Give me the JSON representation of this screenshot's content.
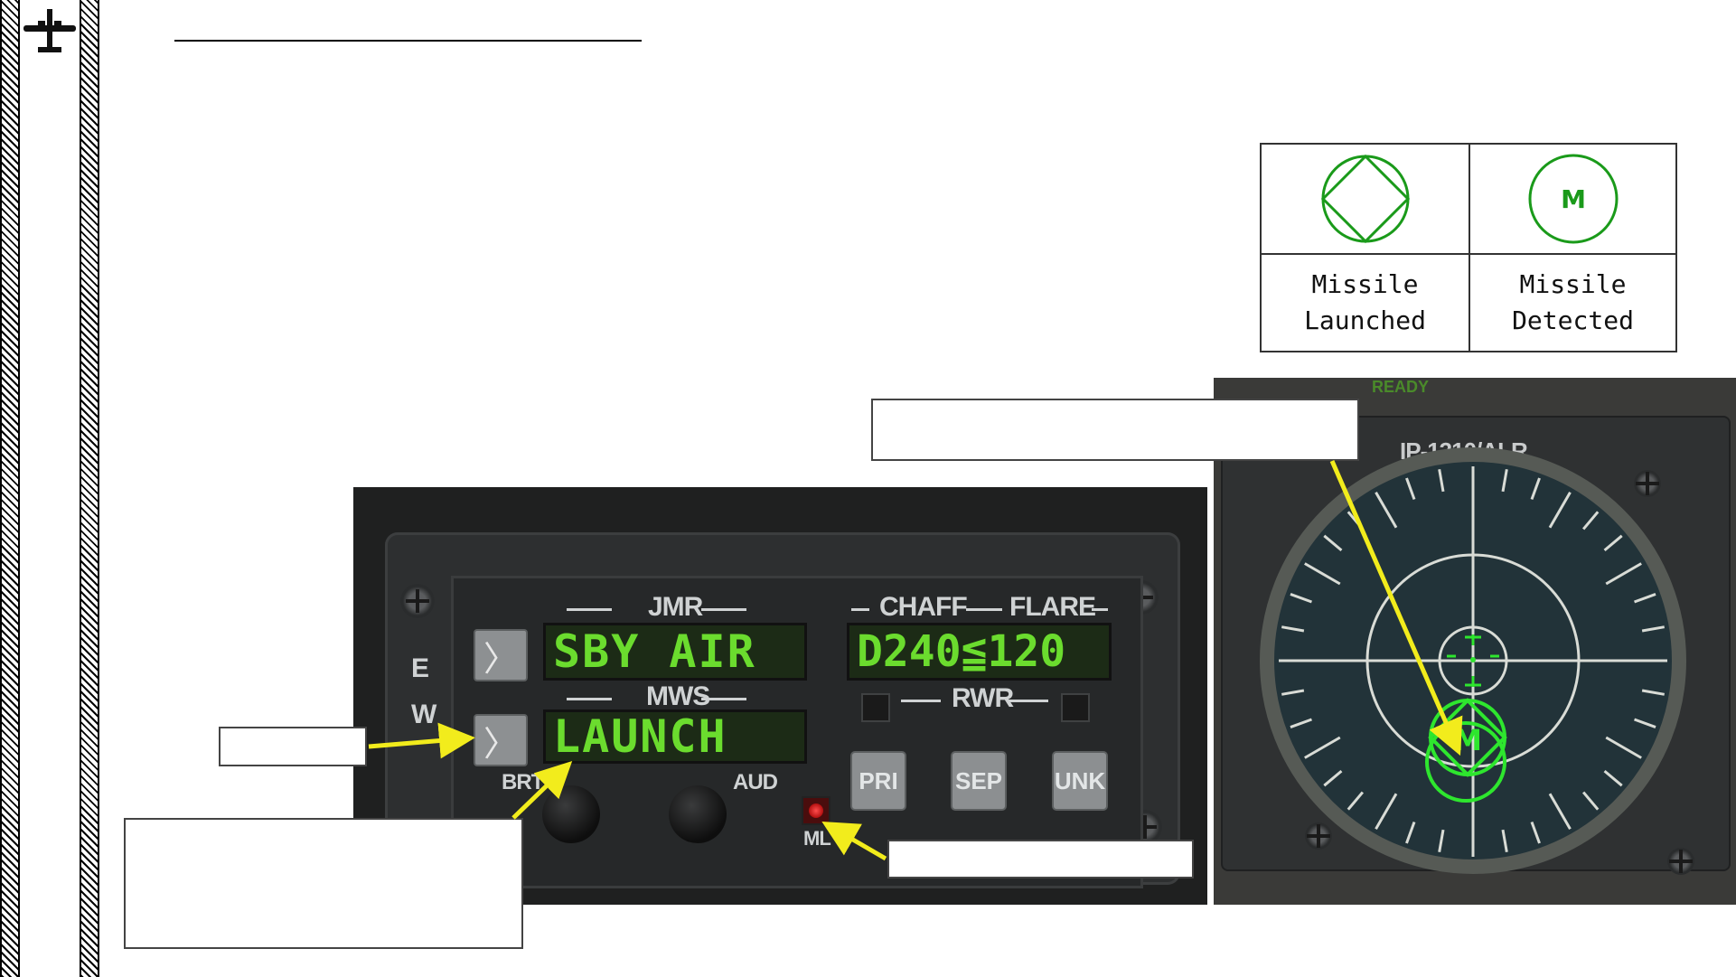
{
  "legend": {
    "missile_launched": "Missile\nLaunched",
    "missile_detected": "Missile\nDetected",
    "detected_symbol": "M",
    "symbol_color": "#1a9a1a"
  },
  "panel": {
    "side_label_e": "E",
    "side_label_w": "W",
    "jmr_label": "JMR",
    "chaff_label": "CHAFF",
    "flare_label": "FLARE",
    "mws_label": "MWS",
    "rwr_label": "RWR",
    "jmr_display": "SBY AIR",
    "cm_display": "D240≦120",
    "mws_display": "LAUNCH",
    "arrow_glyph": "〉",
    "brt_label": "BRT",
    "aud_label": "AUD",
    "ml_label": "ML",
    "pri_label": "PRI",
    "sep_label": "SEP",
    "unk_label": "UNK",
    "lcd_color": "#6bdc2e",
    "led_color": "#ff3333"
  },
  "rwr": {
    "model_label": "IP-1310/ALR",
    "top_label": "READY",
    "detected_symbol": "M",
    "symbol_color": "#2ee62e"
  },
  "callouts": {
    "arrow_color": "#f2ec1c"
  }
}
